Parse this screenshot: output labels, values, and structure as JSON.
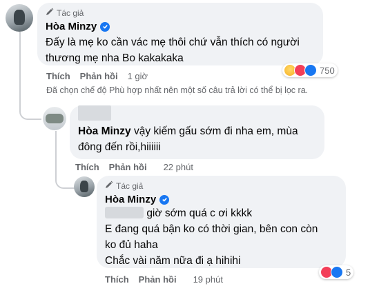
{
  "comment1": {
    "author_badge": "Tác giả",
    "author": "Hòa Minzy",
    "text_lines": [
      "Đấy là mẹ ko cần vác mẹ thôi chứ vẫn thích có người",
      "thương mẹ nha Bo kakakaka"
    ],
    "actions": {
      "like": "Thích",
      "reply": "Phản hồi",
      "time": "1 giờ"
    },
    "reaction_count": "750"
  },
  "filter_notice": "Đã chọn chế độ Phù hợp nhất nên một số câu trả lời có thể bị lọc ra.",
  "comment2": {
    "author": "Hòa Minzy",
    "text_after_name": "vậy kiếm gấu sớm đi nha em, mùa",
    "text_line2": "đông đến rồi,hiiiiii",
    "actions": {
      "like": "Thích",
      "reply": "Phản hồi",
      "time": "22 phút"
    }
  },
  "comment3": {
    "author_badge": "Tác giả",
    "author": "Hòa Minzy",
    "text_line1_after_blur": "giờ sớm quá c ơi kkkk",
    "text_lines": [
      "E đang quá bận ko có thời gian, bên con còn",
      "ko đủ haha",
      "Chắc vài năm nữa đi ạ hihihi"
    ],
    "actions": {
      "like": "Thích",
      "reply": "Phản hồi",
      "time": "19 phút"
    },
    "reaction_count": "5"
  },
  "colors": {
    "bubble": "#f0f2f5",
    "verified": "#1877f2",
    "muted": "#65676b",
    "like_blue": "#1877f2",
    "love_red": "#f33e58",
    "haha_yellow": "#f7b125"
  },
  "icons": [
    "pen-icon",
    "verified-badge-icon",
    "haha-reaction-icon",
    "love-reaction-icon",
    "like-reaction-icon"
  ]
}
